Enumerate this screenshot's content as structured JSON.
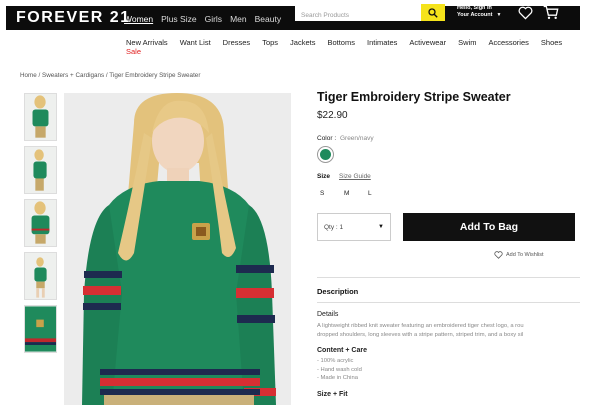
{
  "header": {
    "logo": "FOREVER 21",
    "categories": [
      "Women",
      "Plus Size",
      "Girls",
      "Men",
      "Beauty"
    ],
    "search_placeholder": "Search Products",
    "account_line1": "Hello, Sign In",
    "account_line2": "Your Account"
  },
  "subnav": {
    "items": [
      "New Arrivals",
      "Want List",
      "Dresses",
      "Tops",
      "Jackets",
      "Bottoms",
      "Intimates",
      "Activewear",
      "Swim",
      "Accessories",
      "Shoes"
    ],
    "sale_label": "Sale"
  },
  "breadcrumb": "Home / Sweaters + Cardigans / Tiger Embroidery Stripe Sweater",
  "product": {
    "title": "Tiger Embroidery Stripe Sweater",
    "price": "$22.90",
    "color_label": "Color :",
    "color_value": "Green/navy",
    "swatch_color": "#1f8a5c",
    "size_label": "Size",
    "size_guide": "Size Guide",
    "sizes": [
      "S",
      "M",
      "L"
    ],
    "qty_label": "Qty : 1",
    "add_to_bag": "Add To Bag",
    "wishlist": "Add To Wishlist"
  },
  "description": {
    "heading": "Description",
    "details_heading": "Details",
    "details_line1": "A lightweight ribbed knit sweater featuring an embroidered tiger chest logo, a rou",
    "details_line2": "dropped shoulders, long sleeves with a stripe pattern, striped trim, and a boxy sil",
    "content_heading": "Content + Care",
    "content_items": [
      "- 100% acrylic",
      "- Hand wash cold",
      "- Made in China"
    ],
    "size_fit_heading": "Size + Fit"
  },
  "colors": {
    "accent_yellow": "#f5e31b",
    "sale_red": "#e02020",
    "sweater_green": "#1f8a5c"
  }
}
